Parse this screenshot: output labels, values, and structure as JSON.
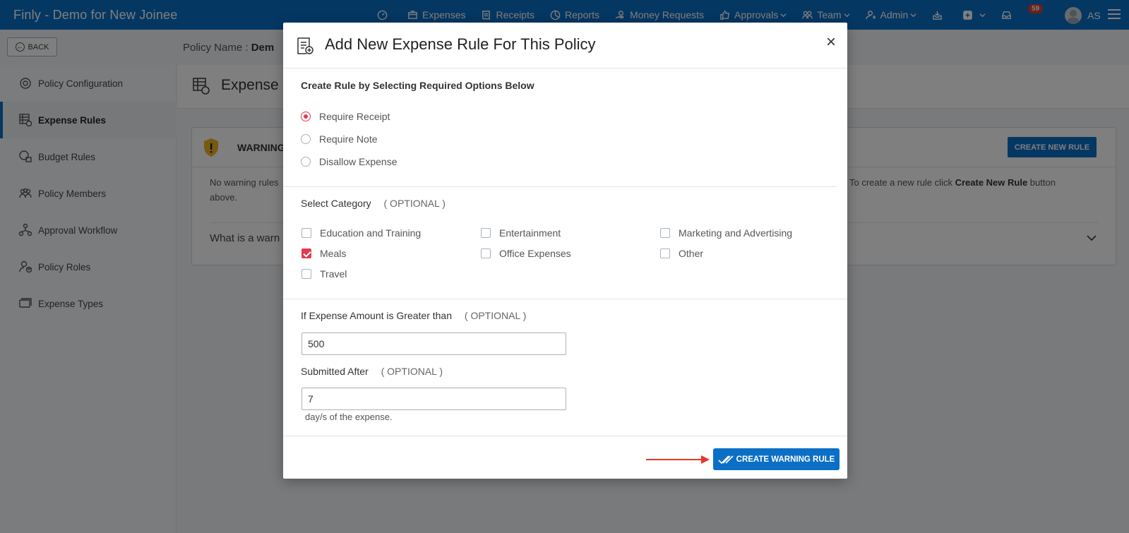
{
  "app": {
    "title": "Finly - Demo for New Joinee",
    "notification_count": "59",
    "user_initials": "AS"
  },
  "nav": {
    "items": [
      {
        "label": "",
        "icon": "dashboard-icon"
      },
      {
        "label": "Expenses",
        "icon": "expenses-icon"
      },
      {
        "label": "Receipts",
        "icon": "receipts-icon"
      },
      {
        "label": "Reports",
        "icon": "reports-icon"
      },
      {
        "label": "Money Requests",
        "icon": "money-requests-icon"
      },
      {
        "label": "Approvals",
        "icon": "approvals-icon"
      },
      {
        "label": "Team",
        "icon": "team-icon"
      },
      {
        "label": "Admin",
        "icon": "admin-icon"
      }
    ]
  },
  "subheader": {
    "back_label": "BACK",
    "policy_name_label": "Policy Name :",
    "policy_name_value": "Dem"
  },
  "sidebar": {
    "items": [
      {
        "label": "Policy Configuration",
        "icon": "policy-configuration-icon"
      },
      {
        "label": "Expense Rules",
        "icon": "expense-rules-icon",
        "active": true
      },
      {
        "label": "Budget Rules",
        "icon": "budget-rules-icon"
      },
      {
        "label": "Policy Members",
        "icon": "policy-members-icon"
      },
      {
        "label": "Approval Workflow",
        "icon": "approval-workflow-icon"
      },
      {
        "label": "Policy Roles",
        "icon": "policy-roles-icon"
      },
      {
        "label": "Expense Types",
        "icon": "expense-types-icon"
      }
    ]
  },
  "main": {
    "title": "Expense",
    "warning_title": "WARNING",
    "create_new_rule_label": "CREATE NEW RULE",
    "no_rules_text": "No warning rules",
    "no_rules_text_cont": "above.",
    "create_hint_text": "To create a new rule click",
    "create_hint_bold": "Create New Rule",
    "create_hint_suffix": "button",
    "what_is_text": "What is a warn"
  },
  "modal": {
    "title": "Add New Expense Rule For This Policy",
    "close_label": "×",
    "create_rule_heading": "Create Rule by Selecting Required Options Below",
    "rule_options": [
      {
        "label": "Require Receipt",
        "checked": true
      },
      {
        "label": "Require Note",
        "checked": false
      },
      {
        "label": "Disallow Expense",
        "checked": false
      }
    ],
    "category_heading": "Select Category",
    "optional_label": "( OPTIONAL )",
    "categories": [
      {
        "label": "Education and Training",
        "checked": false
      },
      {
        "label": "Entertainment",
        "checked": false
      },
      {
        "label": "Marketing and Advertising",
        "checked": false
      },
      {
        "label": "Meals",
        "checked": true
      },
      {
        "label": "Office Expenses",
        "checked": false
      },
      {
        "label": "Other",
        "checked": false
      },
      {
        "label": "Travel",
        "checked": false
      }
    ],
    "amount_heading": "If Expense Amount is Greater than",
    "amount_value": "500",
    "submitted_heading": "Submitted After",
    "submitted_value": "7",
    "days_note": "day/s of the expense.",
    "create_warning_label": "CREATE WARNING RULE"
  },
  "colors": {
    "brand_blue": "#0b6fc6",
    "accent_red": "#e23c4e",
    "warning_yellow": "#f0b323"
  }
}
